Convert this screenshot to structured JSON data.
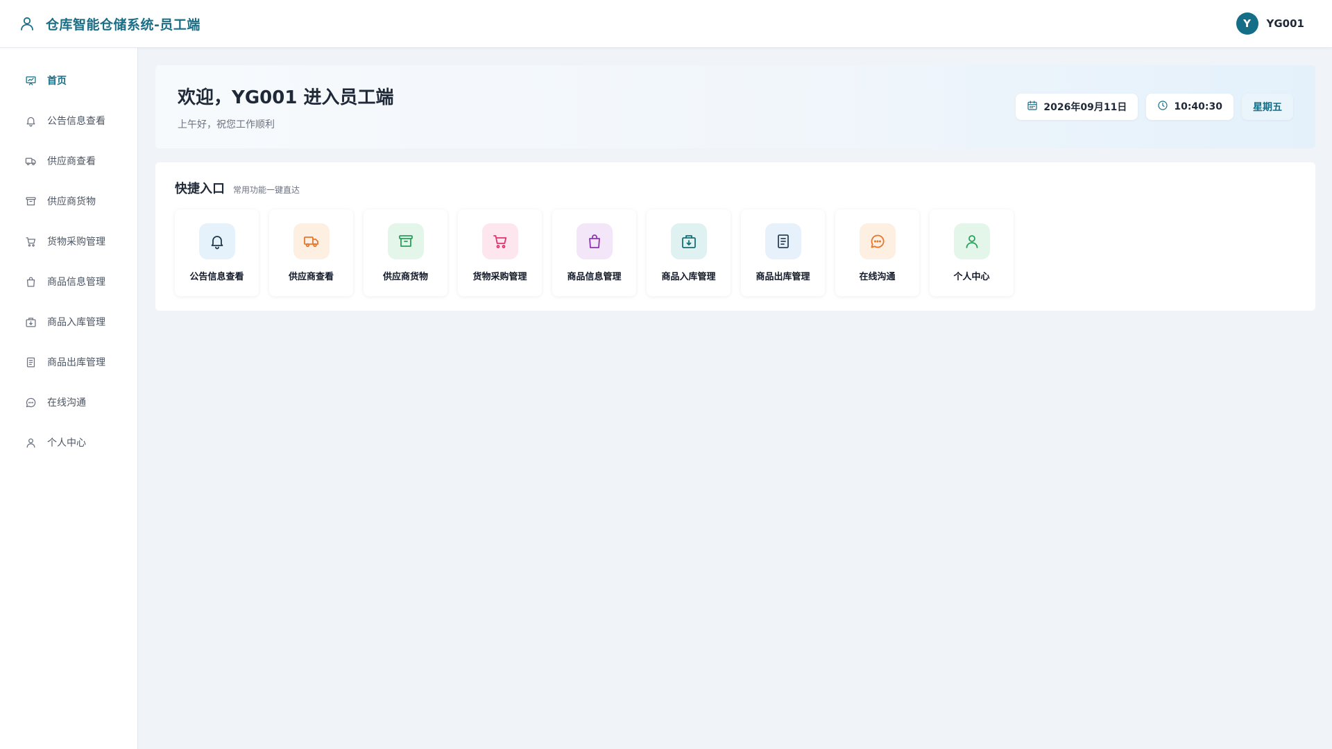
{
  "header": {
    "title": "仓库智能仓储系统-员工端",
    "brand_icon": "user-outline-icon",
    "user": {
      "avatar_initial": "Y",
      "name": "YG001"
    },
    "brand_color": "#1a6e86"
  },
  "sidebar": {
    "items": [
      {
        "label": "首页",
        "icon": "dashboard-icon",
        "active": true
      },
      {
        "label": "公告信息查看",
        "icon": "bell-icon"
      },
      {
        "label": "供应商查看",
        "icon": "truck-icon"
      },
      {
        "label": "供应商货物",
        "icon": "archive-box-icon"
      },
      {
        "label": "货物采购管理",
        "icon": "cart-icon"
      },
      {
        "label": "商品信息管理",
        "icon": "shopping-bag-icon"
      },
      {
        "label": "商品入库管理",
        "icon": "package-in-icon"
      },
      {
        "label": "商品出库管理",
        "icon": "document-list-icon"
      },
      {
        "label": "在线沟通",
        "icon": "chat-bubble-icon"
      },
      {
        "label": "个人中心",
        "icon": "user-icon"
      }
    ]
  },
  "welcome": {
    "title": "欢迎，YG001 进入员工端",
    "subtitle": "上午好，祝您工作顺利",
    "date": "2026年09月11日",
    "time": "10:40:30",
    "weekday": "星期五"
  },
  "quick": {
    "title": "快捷入口",
    "subtitle": "常用功能一键直达",
    "tiles": [
      {
        "label": "公告信息查看",
        "icon": "bell-icon",
        "color": "#1f3a4d",
        "bg": "#e6f2fb"
      },
      {
        "label": "供应商查看",
        "icon": "truck-icon",
        "color": "#e8762b",
        "bg": "#fdefe2"
      },
      {
        "label": "供应商货物",
        "icon": "archive-box-icon",
        "color": "#27a05b",
        "bg": "#e4f5ea"
      },
      {
        "label": "货物采购管理",
        "icon": "cart-icon",
        "color": "#e0336d",
        "bg": "#fde6ee"
      },
      {
        "label": "商品信息管理",
        "icon": "shopping-bag-icon",
        "color": "#8e35b5",
        "bg": "#f3e6f8"
      },
      {
        "label": "商品入库管理",
        "icon": "package-in-icon",
        "color": "#156e73",
        "bg": "#e0f1f1"
      },
      {
        "label": "商品出库管理",
        "icon": "document-list-icon",
        "color": "#2c4257",
        "bg": "#e6f1fb"
      },
      {
        "label": "在线沟通",
        "icon": "chat-bubble-icon",
        "color": "#e8762b",
        "bg": "#fdefe2"
      },
      {
        "label": "个人中心",
        "icon": "user-icon",
        "color": "#27a05b",
        "bg": "#e4f5ea"
      }
    ]
  }
}
